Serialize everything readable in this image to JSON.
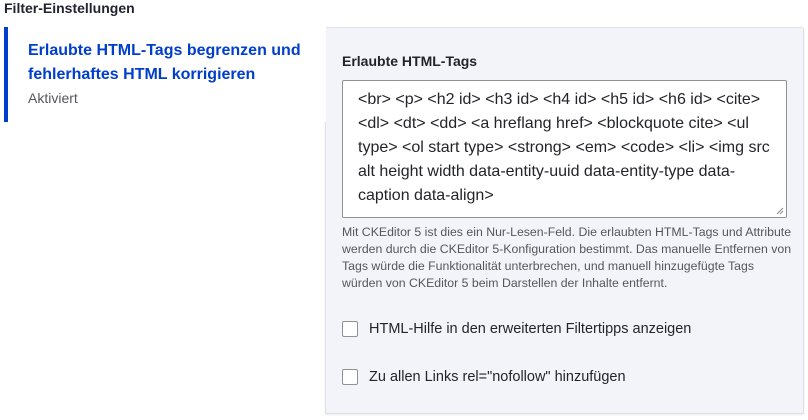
{
  "section": {
    "title": "Filter-Einstellungen"
  },
  "vertical_tab": {
    "title": "Erlaubte HTML-Tags begrenzen und fehlerhaftes HTML korrigieren",
    "summary": "Aktiviert",
    "active": true,
    "accent_color": "#003ecc"
  },
  "panel": {
    "allowed_tags_label": "Erlaubte HTML-Tags",
    "allowed_tags_value": "<br> <p> <h2 id> <h3 id> <h4 id> <h5 id> <h6 id> <cite> <dl> <dt> <dd> <a hreflang href> <blockquote cite> <ul type> <ol start type> <strong> <em> <code> <li> <img src alt height width data-entity-uuid data-entity-type data-caption data-align>",
    "readonly": true,
    "description": "Mit CKEditor 5 ist dies ein Nur-Lesen-Feld. Die erlaubten HTML-Tags und Attribute werden durch die CKEditor 5-Konfiguration bestimmt. Das manuelle Entfernen von Tags würde die Funktionalität unterbrechen, und manuell hinzugefügte Tags würden von CKEditor 5 beim Darstellen der Inhalte entfernt.",
    "checkboxes": [
      {
        "label": "HTML-Hilfe in den erweiterten Filtertipps anzeigen",
        "checked": false
      },
      {
        "label": "Zu allen Links rel=\"nofollow\" hinzufügen",
        "checked": false
      }
    ]
  }
}
